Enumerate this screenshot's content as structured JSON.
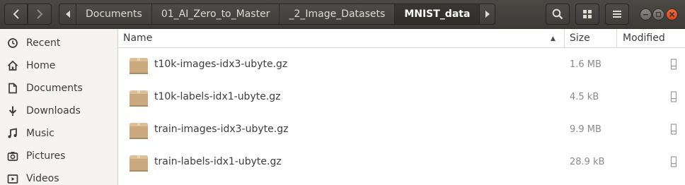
{
  "breadcrumbs": [
    {
      "label": "Documents"
    },
    {
      "label": "01_AI_Zero_to_Master"
    },
    {
      "label": "_2_Image_Datasets"
    },
    {
      "label": "MNIST_data"
    }
  ],
  "sidebar": {
    "items": [
      {
        "label": "Recent",
        "icon": "clock-icon"
      },
      {
        "label": "Home",
        "icon": "home-icon"
      },
      {
        "label": "Documents",
        "icon": "document-icon"
      },
      {
        "label": "Downloads",
        "icon": "download-icon"
      },
      {
        "label": "Music",
        "icon": "music-icon"
      },
      {
        "label": "Pictures",
        "icon": "camera-icon"
      },
      {
        "label": "Videos",
        "icon": "video-icon"
      }
    ]
  },
  "columns": {
    "name": "Name",
    "size": "Size",
    "modified": "Modified"
  },
  "files": [
    {
      "name": "t10k-images-idx3-ubyte.gz",
      "size": "1.6 MB"
    },
    {
      "name": "t10k-labels-idx1-ubyte.gz",
      "size": "4.5 kB"
    },
    {
      "name": "train-images-idx3-ubyte.gz",
      "size": "9.9 MB"
    },
    {
      "name": "train-labels-idx1-ubyte.gz",
      "size": "28.9 kB"
    }
  ],
  "colors": {
    "headerbar": "#3c3b37",
    "sidebar": "#f5f4f3",
    "archive_icon": "#c8a87c",
    "window_close": "#df4a16"
  }
}
